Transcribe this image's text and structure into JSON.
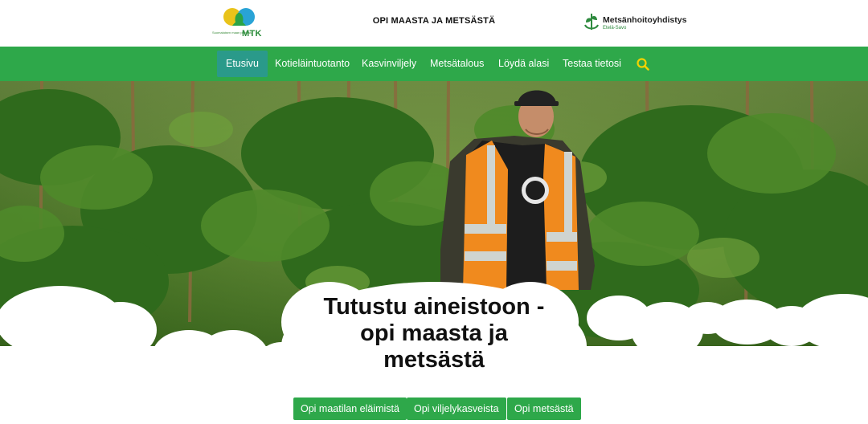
{
  "header": {
    "left_logo": {
      "name": "MTK",
      "tagline": "Suomalaisen maan puolesta"
    },
    "site_title": "OPI MAASTA JA METSÄSTÄ",
    "right_logo": {
      "name": "Metsänhoitoyhdistys",
      "region": "Etelä-Savo"
    }
  },
  "nav": {
    "items": [
      {
        "label": "Etusivu",
        "active": true
      },
      {
        "label": "Kotieläintuotanto",
        "active": false
      },
      {
        "label": "Kasvinviljely",
        "active": false
      },
      {
        "label": "Metsätalous",
        "active": false
      },
      {
        "label": "Löydä alasi",
        "active": false
      },
      {
        "label": "Testaa tietosi",
        "active": false
      }
    ],
    "search_icon": "search-icon"
  },
  "hero": {
    "title_lines": [
      "Tutustu aineistoon -",
      "opi maasta ja",
      "metsästä"
    ],
    "buttons": [
      {
        "label": "Opi maatilan eläimistä"
      },
      {
        "label": "Opi viljelykasveista"
      },
      {
        "label": "Opi metsästä"
      }
    ]
  },
  "colors": {
    "brand_green": "#2ea84a",
    "active_tab": "#2a9a8a",
    "search_icon": "#f5d200",
    "vest_orange": "#f08a1e"
  }
}
